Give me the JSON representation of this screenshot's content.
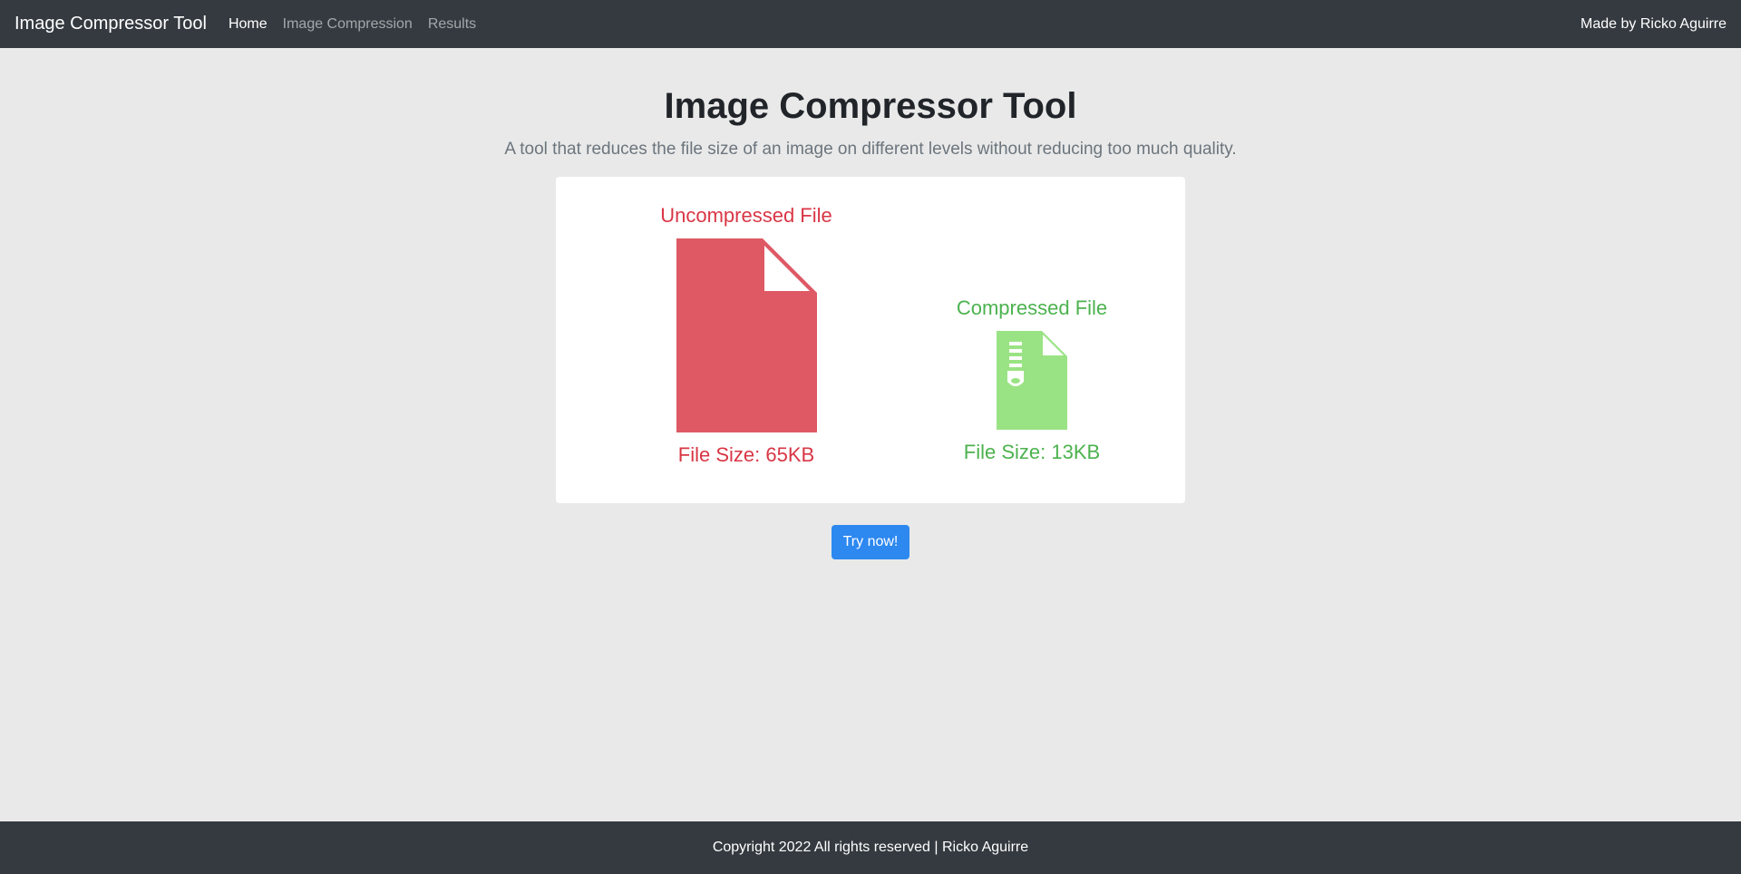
{
  "nav": {
    "brand": "Image Compressor Tool",
    "links": [
      {
        "label": "Home",
        "active": true
      },
      {
        "label": "Image Compression",
        "active": false
      },
      {
        "label": "Results",
        "active": false
      }
    ],
    "made_by": "Made by Ricko Aguirre"
  },
  "hero": {
    "title": "Image Compressor Tool",
    "subtitle": "A tool that reduces the file size of an image on different levels without reducing too much quality."
  },
  "comparison": {
    "uncompressed": {
      "title": "Uncompressed File",
      "size_label": "File Size: 65KB",
      "icon": "file-icon",
      "color": "#de5964"
    },
    "compressed": {
      "title": "Compressed File",
      "size_label": "File Size: 13KB",
      "icon": "zip-file-icon",
      "color": "#9ae384"
    }
  },
  "cta": {
    "label": "Try now!"
  },
  "footer": {
    "text": "Copyright 2022 All rights reserved | Ricko Aguirre"
  }
}
